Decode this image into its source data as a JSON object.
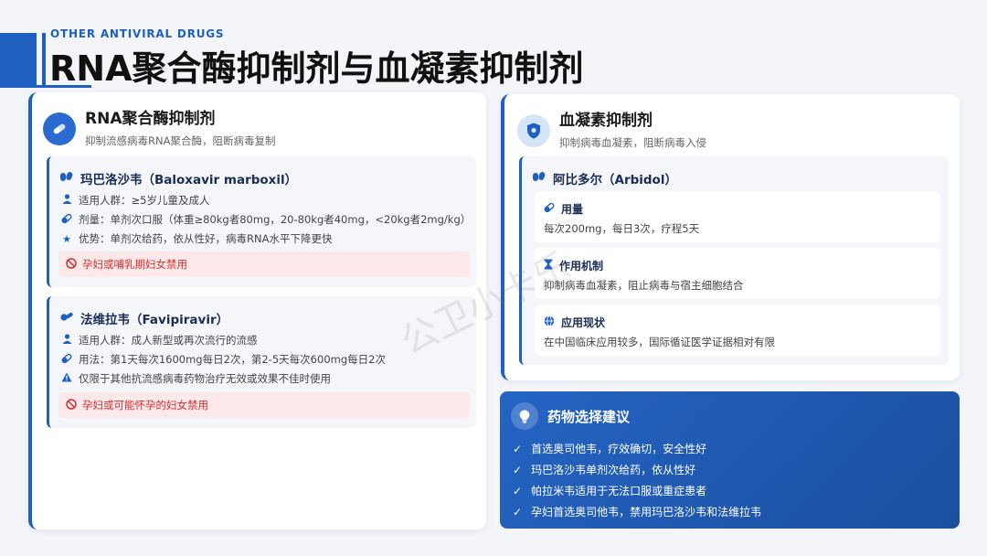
{
  "header": {
    "eyebrow": "OTHER ANTIVIRAL DRUGS",
    "title": "RNA聚合酶抑制剂与血凝素抑制剂"
  },
  "left_card": {
    "icon": "pills-icon",
    "title": "RNA聚合酶抑制剂",
    "subtitle": "抑制流感病毒RNA聚合酶，阻断病毒复制",
    "drugs": [
      {
        "name": "玛巴洛沙韦（Baloxavir marboxil）",
        "icon": "capsules-icon",
        "lines": [
          {
            "icon": "user-icon",
            "text": "适用人群：≥5岁儿童及成人"
          },
          {
            "icon": "capsule-icon",
            "text": "剂量：单剂次口服（体重≥80kg者80mg，20-80kg者40mg，<20kg者2mg/kg）"
          },
          {
            "icon": "star-icon",
            "text": "优势：单剂次给药，依从性好，病毒RNA水平下降更快"
          }
        ],
        "warning": "孕妇或哺乳期妇女禁用"
      },
      {
        "name": "法维拉韦（Favipiravir）",
        "icon": "tablets-icon",
        "lines": [
          {
            "icon": "user-icon",
            "text": "适用人群：成人新型或再次流行的流感"
          },
          {
            "icon": "capsule-icon",
            "text": "用法：第1天每次1600mg每日2次，第2-5天每次600mg每日2次"
          },
          {
            "icon": "warning-icon",
            "text": "仅限于其他抗流感病毒药物治疗无效或效果不佳时使用"
          }
        ],
        "warning": "孕妇或可能怀孕的妇女禁用"
      }
    ]
  },
  "right_card": {
    "icon": "shield-virus-icon",
    "title": "血凝素抑制剂",
    "subtitle": "抑制病毒血凝素，阻断病毒入侵",
    "drug": {
      "name": "阿比多尔（Arbidol）",
      "icon": "capsules-icon",
      "sections": [
        {
          "icon": "capsule-icon",
          "title": "用量",
          "text": "每次200mg，每日3次，疗程5天"
        },
        {
          "icon": "hourglass-icon",
          "title": "作用机制",
          "text": "抑制病毒血凝素，阻止病毒与宿主细胞结合"
        },
        {
          "icon": "globe-icon",
          "title": "应用现状",
          "text": "在中国临床应用较多，国际循证医学证据相对有限"
        }
      ]
    }
  },
  "advice": {
    "icon": "lightbulb-icon",
    "title": "药物选择建议",
    "items": [
      "首选奥司他韦，疗效确切，安全性好",
      "玛巴洛沙韦单剂次给药，依从性好",
      "帕拉米韦适用于无法口服或重症患者",
      "孕妇首选奥司他韦，禁用玛巴洛沙韦和法维拉韦"
    ]
  },
  "watermark": "公卫小卡乐",
  "colors": {
    "accent": "#1e5fbf",
    "warning_bg": "#fde9ea",
    "warning_text": "#d32f2f",
    "advice_bg": "#2464c4"
  }
}
